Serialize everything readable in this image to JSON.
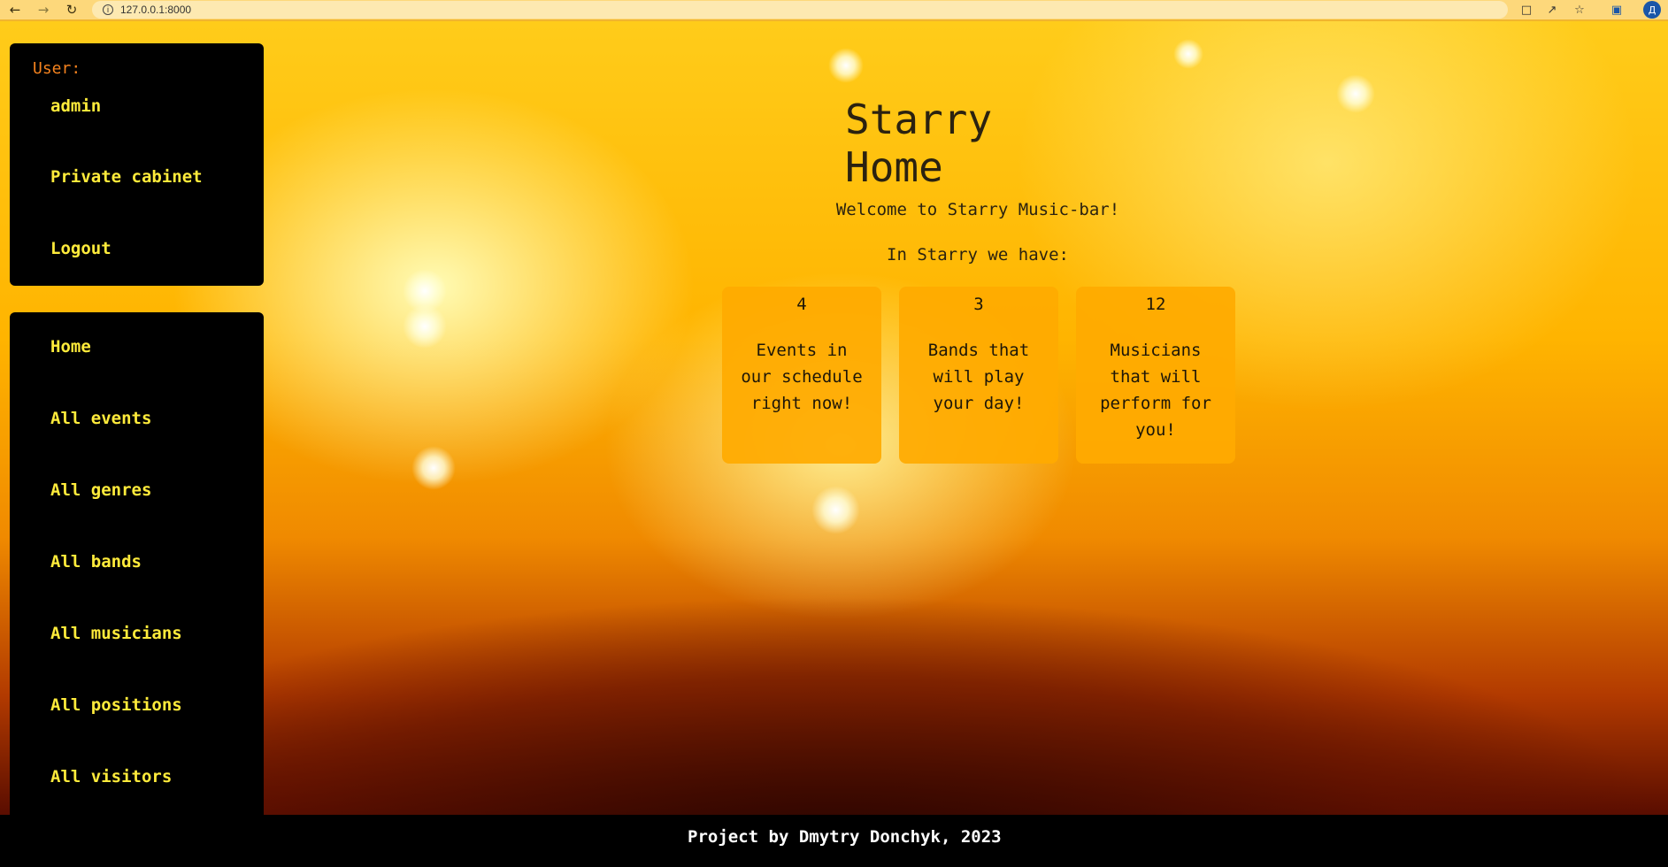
{
  "browser": {
    "url": "127.0.0.1:8000",
    "profile_initial": "Д",
    "icons": [
      "back-icon",
      "forward-icon",
      "reload-icon",
      "info-icon",
      "translate-icon",
      "share-icon",
      "star-icon",
      "sidepanel-icon"
    ]
  },
  "user_panel": {
    "label": "User:",
    "username": "admin",
    "private_cabinet": "Private cabinet",
    "logout": "Logout"
  },
  "nav": {
    "items": [
      {
        "label": "Home"
      },
      {
        "label": "All events"
      },
      {
        "label": "All genres"
      },
      {
        "label": "All bands"
      },
      {
        "label": "All musicians"
      },
      {
        "label": "All positions"
      },
      {
        "label": "All visitors"
      }
    ]
  },
  "main": {
    "title": "Starry Home",
    "welcome": "Welcome to Starry Music-bar!",
    "intro": "In Starry we have:",
    "cards": [
      {
        "count": "4",
        "text": "Events in our schedule right now!"
      },
      {
        "count": "3",
        "text": "Bands that will play your day!"
      },
      {
        "count": "12",
        "text": "Musicians that will perform for you!"
      }
    ]
  },
  "footer": {
    "text": "Project by Dmytry Donchyk, 2023"
  },
  "colors": {
    "nav_text": "#ffeb3b",
    "user_label": "#f4821e",
    "card_bg": "#ffaa00",
    "panel_bg": "#000000"
  }
}
